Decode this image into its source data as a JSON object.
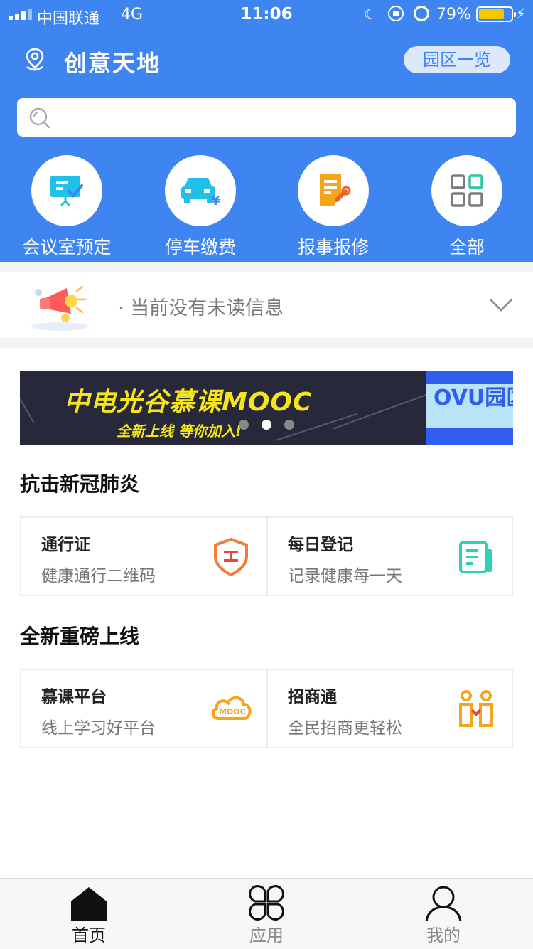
{
  "status_bar": {
    "carrier": "中国联通",
    "network": "4G",
    "time": "11:06",
    "battery_percent": "79%",
    "battery_level": 0.79,
    "battery_color": "#f7c600"
  },
  "header": {
    "title": "创意天地",
    "park_button": "园区一览",
    "location_icon": "location-pin-icon"
  },
  "search": {
    "placeholder": "",
    "icon": "search-icon"
  },
  "quick_actions": [
    {
      "label": "会议室预定",
      "icon": "meeting-room-icon",
      "color": "#21c0e8"
    },
    {
      "label": "停车缴费",
      "icon": "parking-car-icon",
      "color": "#21c0e8"
    },
    {
      "label": "报事报修",
      "icon": "repair-report-icon",
      "color": "#f5a51a"
    },
    {
      "label": "全部",
      "icon": "grid-all-icon",
      "color": "#7b7b7b"
    }
  ],
  "notice": {
    "message": "· 当前没有未读信息",
    "icon": "megaphone-icon"
  },
  "banner": {
    "title": "中电光谷慕课MOOC",
    "subtitle": "全新上线  等你加入!",
    "right_text": "OVU园区",
    "slide_count": 3,
    "active_slide": 2
  },
  "sections": [
    {
      "title": "抗击新冠肺炎",
      "cards": [
        {
          "title": "通行证",
          "subtitle": "健康通行二维码",
          "icon": "shield-pass-icon"
        },
        {
          "title": "每日登记",
          "subtitle": "记录健康每一天",
          "icon": "register-doc-icon"
        }
      ]
    },
    {
      "title": "全新重磅上线",
      "cards": [
        {
          "title": "慕课平台",
          "subtitle": "线上学习好平台",
          "icon": "mooc-cloud-icon",
          "icon_text": "MOOC"
        },
        {
          "title": "招商通",
          "subtitle": "全民招商更轻松",
          "icon": "business-invest-icon"
        }
      ]
    }
  ],
  "tabbar": [
    {
      "label": "首页",
      "icon": "home-icon",
      "active": true
    },
    {
      "label": "应用",
      "icon": "apps-icon",
      "active": false
    },
    {
      "label": "我的",
      "icon": "profile-icon",
      "active": false
    }
  ],
  "colors": {
    "primary": "#3e85f2",
    "accent_orange": "#f5a51a",
    "accent_cyan": "#21c0e8",
    "banner_yellow": "#f5e51a"
  }
}
